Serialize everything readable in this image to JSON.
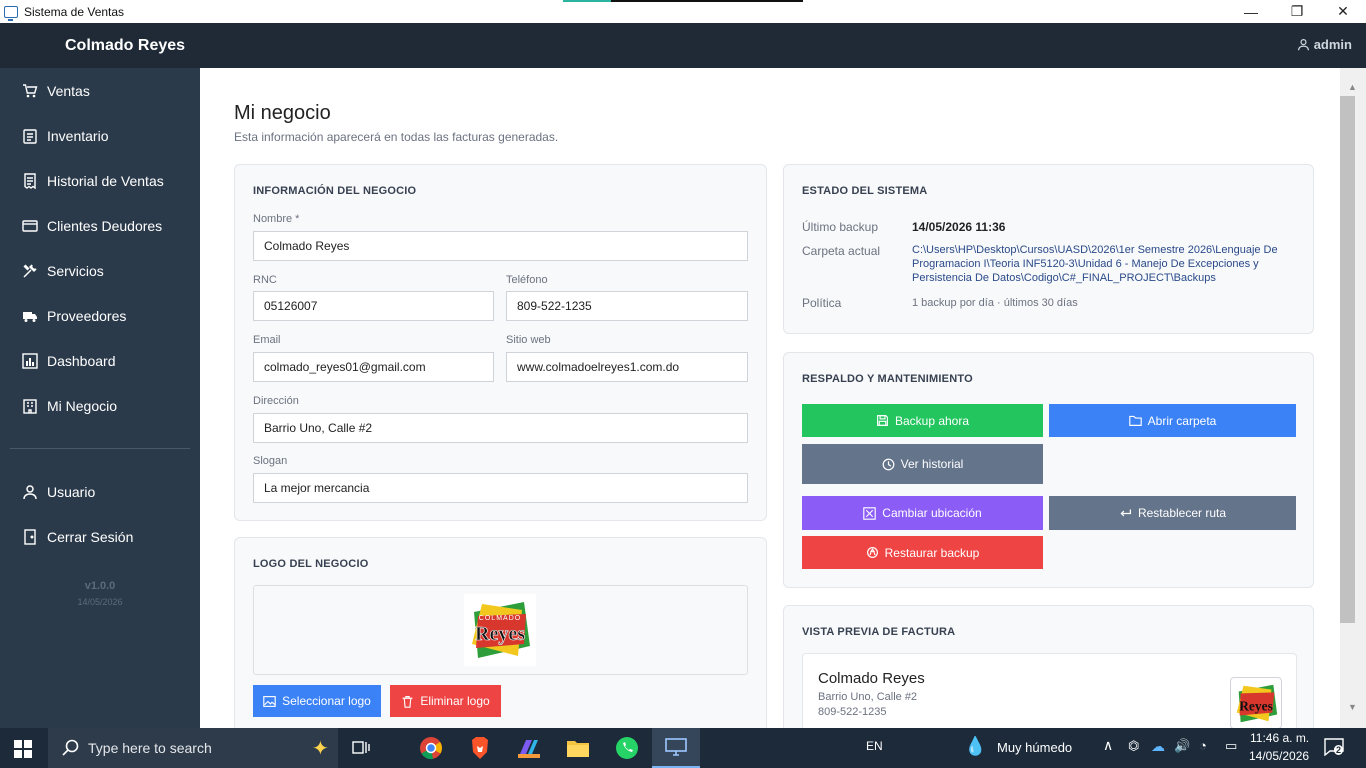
{
  "window": {
    "title": "Sistema de Ventas",
    "controls": {
      "minimize": "—",
      "maximize": "❐",
      "close": "✕"
    }
  },
  "header": {
    "brand": "Colmado Reyes",
    "user": "admin"
  },
  "sidebar": {
    "items": [
      {
        "label": "Ventas",
        "icon": "cart-icon"
      },
      {
        "label": "Inventario",
        "icon": "clipboard-icon"
      },
      {
        "label": "Historial de Ventas",
        "icon": "receipt-icon"
      },
      {
        "label": "Clientes Deudores",
        "icon": "card-icon"
      },
      {
        "label": "Servicios",
        "icon": "tools-icon"
      },
      {
        "label": "Proveedores",
        "icon": "truck-icon"
      },
      {
        "label": "Dashboard",
        "icon": "chart-icon"
      },
      {
        "label": "Mi Negocio",
        "icon": "building-icon"
      }
    ],
    "bottom_items": [
      {
        "label": "Usuario",
        "icon": "user-icon"
      },
      {
        "label": "Cerrar Sesión",
        "icon": "door-icon"
      }
    ],
    "version": "v1.0.0",
    "version_date": "14/05/2026"
  },
  "page": {
    "title": "Mi negocio",
    "subtitle": "Esta información aparecerá en todas las facturas generadas."
  },
  "info_card": {
    "title": "INFORMACIÓN DEL NEGOCIO",
    "fields": {
      "nombre": {
        "label": "Nombre *",
        "value": "Colmado Reyes"
      },
      "rnc": {
        "label": "RNC",
        "value": "05126007"
      },
      "telefono": {
        "label": "Teléfono",
        "value": "809-522-1235"
      },
      "email": {
        "label": "Email",
        "value": "colmado_reyes01@gmail.com"
      },
      "sitio_web": {
        "label": "Sitio web",
        "value": "www.colmadoelreyes1.com.do"
      },
      "direccion": {
        "label": "Dirección",
        "value": "Barrio Uno, Calle #2"
      },
      "slogan": {
        "label": "Slogan",
        "value": "La mejor mercancia"
      }
    }
  },
  "logo_card": {
    "title": "LOGO DEL NEGOCIO",
    "logo_top_text": "COLMADO",
    "logo_main_text": "Reyes",
    "select_button": "Seleccionar logo",
    "delete_button": "Eliminar logo"
  },
  "system_card": {
    "title": "ESTADO DEL SISTEMA",
    "last_backup_label": "Último backup",
    "last_backup_value": "14/05/2026  11:36",
    "folder_label": "Carpeta actual",
    "folder_value": "C:\\Users\\HP\\Desktop\\Cursos\\UASD\\2026\\1er Semestre 2026\\Lenguaje De Programacion I\\Teoria INF5120-3\\Unidad 6 - Manejo De Excepciones y Persistencia De Datos\\Codigo\\C#_FINAL_PROJECT\\Backups",
    "policy_label": "Política",
    "policy_value": "1 backup por día · últimos 30 días"
  },
  "backup_card": {
    "title": "RESPALDO Y MANTENIMIENTO",
    "buttons": {
      "backup_now": "Backup ahora",
      "open_folder": "Abrir carpeta",
      "view_history": "Ver historial",
      "change_location": "Cambiar ubicación",
      "reset_path": "Restablecer ruta",
      "restore_backup": "Restaurar backup"
    },
    "colors": {
      "green": "#22c55e",
      "blue": "#3b82f6",
      "gray": "#64748b",
      "purple": "#8b5cf6",
      "red": "#ef4444"
    }
  },
  "preview_card": {
    "title": "VISTA PREVIA DE FACTURA",
    "business_name": "Colmado Reyes",
    "address": "Barrio Uno, Calle #2",
    "phone": "809-522-1235"
  },
  "taskbar": {
    "search_placeholder": "Type here to search",
    "language": "EN",
    "weather": "Muy húmedo",
    "time": "11:46 a. m.",
    "date": "14/05/2026",
    "notifications": "2"
  }
}
